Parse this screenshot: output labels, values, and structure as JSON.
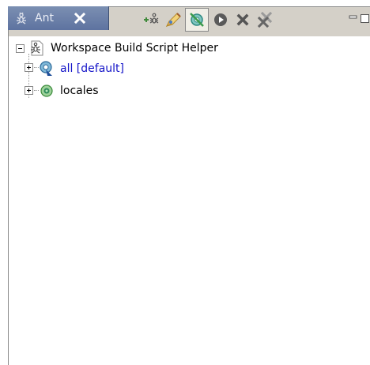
{
  "view": {
    "tab_label": "Ant",
    "tab_icon": "ant-icon",
    "close_icon": "close-icon",
    "toolbar": [
      {
        "name": "add-buildfiles-button",
        "icon": "add-ant-icon"
      },
      {
        "name": "add-buildfiles-search-button",
        "icon": "search-pencil-icon"
      },
      {
        "name": "hide-internal-targets-button",
        "icon": "filter-target-icon"
      },
      {
        "name": "run-target-button",
        "icon": "run-icon"
      },
      {
        "name": "remove-button",
        "icon": "remove-icon"
      },
      {
        "name": "remove-all-button",
        "icon": "remove-all-icon"
      }
    ],
    "window_controls": [
      {
        "name": "minimize-button",
        "icon": "minimize-icon"
      },
      {
        "name": "maximize-button",
        "icon": "maximize-icon"
      }
    ]
  },
  "tree": {
    "root": {
      "label": "Workspace Build Script Helper",
      "icon": "ant-buildfile-icon",
      "expanded": true
    },
    "children": [
      {
        "label": "all [default]",
        "icon": "default-target-icon",
        "expanded": false,
        "is_default": true
      },
      {
        "label": "locales",
        "icon": "target-icon",
        "expanded": false,
        "is_default": false
      }
    ]
  },
  "colors": {
    "tab_active": "#6a7ea8",
    "default_target_text": "#1414c8",
    "toolbar_bg": "#d4d0c8"
  }
}
